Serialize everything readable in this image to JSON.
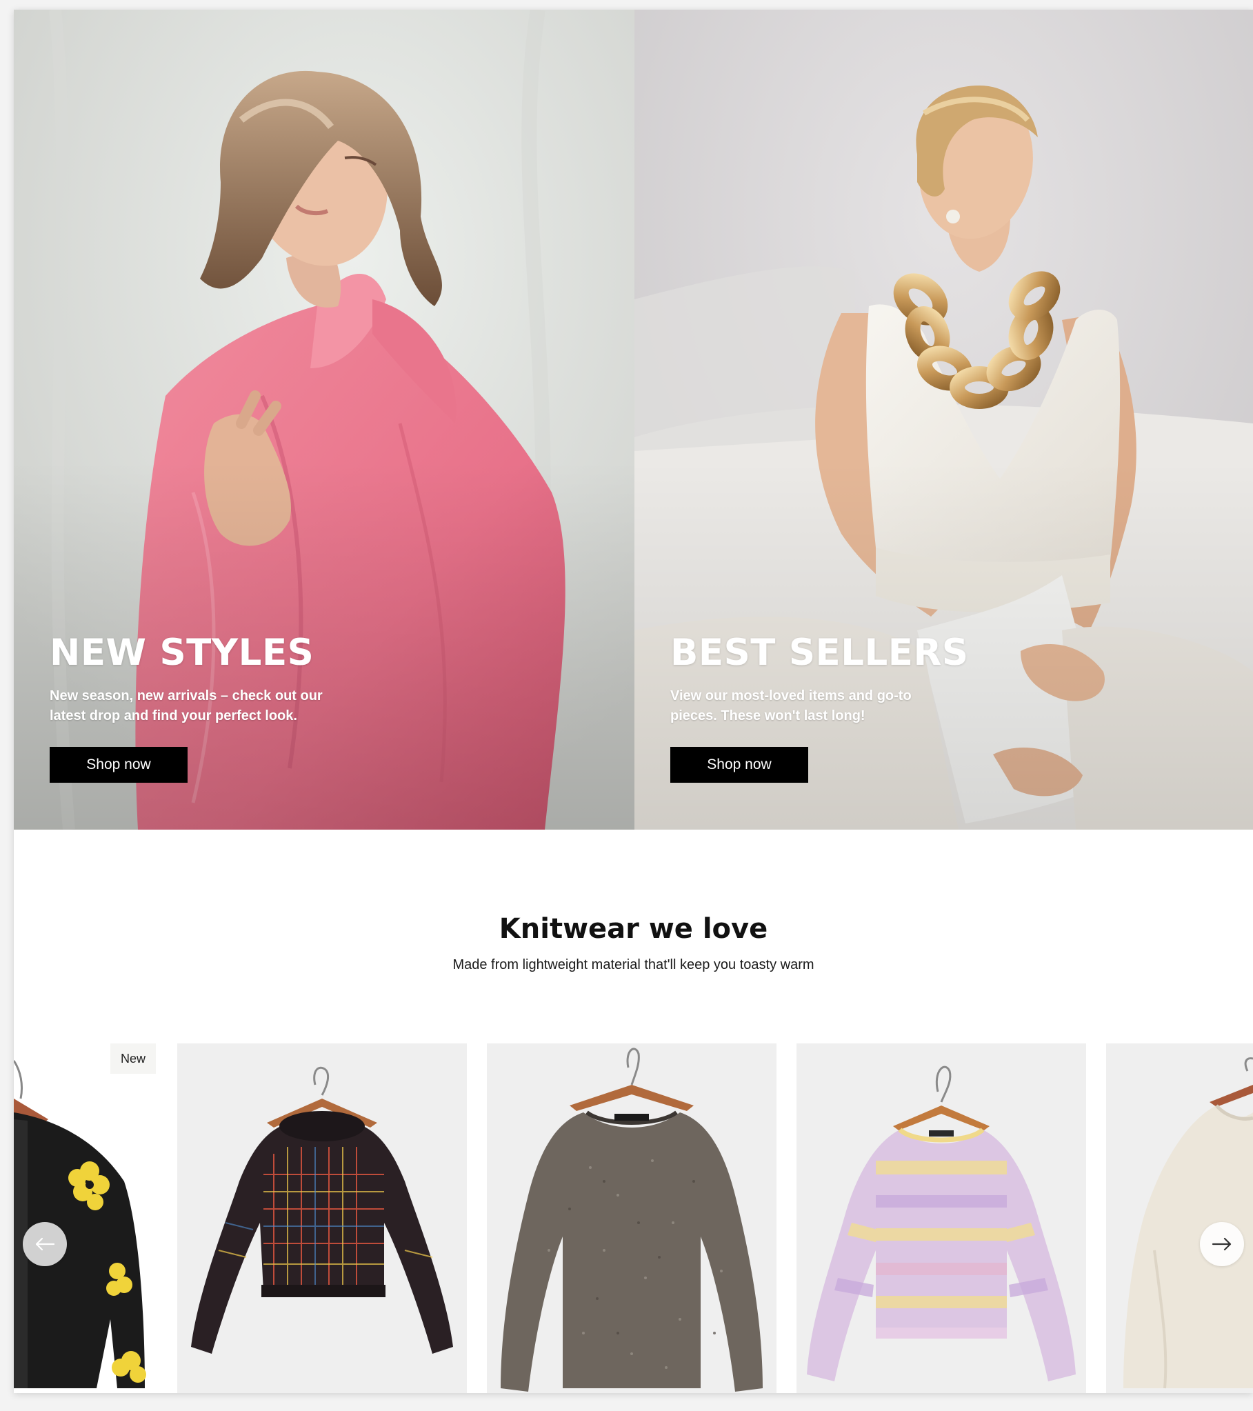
{
  "hero": {
    "left": {
      "title": "NEW STYLES",
      "subtitle": "New season, new arrivals – check out our latest drop and find your perfect look.",
      "button_label": "Shop now"
    },
    "right": {
      "title": "BEST SELLERS",
      "subtitle": "View our most-loved items and go-to pieces. These won't last long!",
      "button_label": "Shop now"
    }
  },
  "section": {
    "title": "Knitwear we love",
    "subtitle": "Made from lightweight material that'll keep you toasty warm"
  },
  "products": [
    {
      "name": "black-floral-cardigan",
      "badge": "New",
      "color": "#1b1b1b",
      "accent": "#f0d33a"
    },
    {
      "name": "check-knit-sweater",
      "color": "#2a2024",
      "accent": "#d9543f"
    },
    {
      "name": "marled-grey-sweater",
      "color": "#6e665e",
      "accent": "#8a8279"
    },
    {
      "name": "pastel-stripe-sweater",
      "color": "#dcc6e3",
      "accent": "#f2df8e"
    },
    {
      "name": "cream-sweater",
      "color": "#ece6da",
      "accent": "#ddd5c6"
    }
  ],
  "carousel": {
    "prev_icon": "arrow-left-icon",
    "next_icon": "arrow-right-icon"
  },
  "colors": {
    "button_bg": "#000000",
    "button_text": "#ffffff",
    "pink_shirt": "#ec7f92",
    "white_knit": "#f3f0ea"
  }
}
